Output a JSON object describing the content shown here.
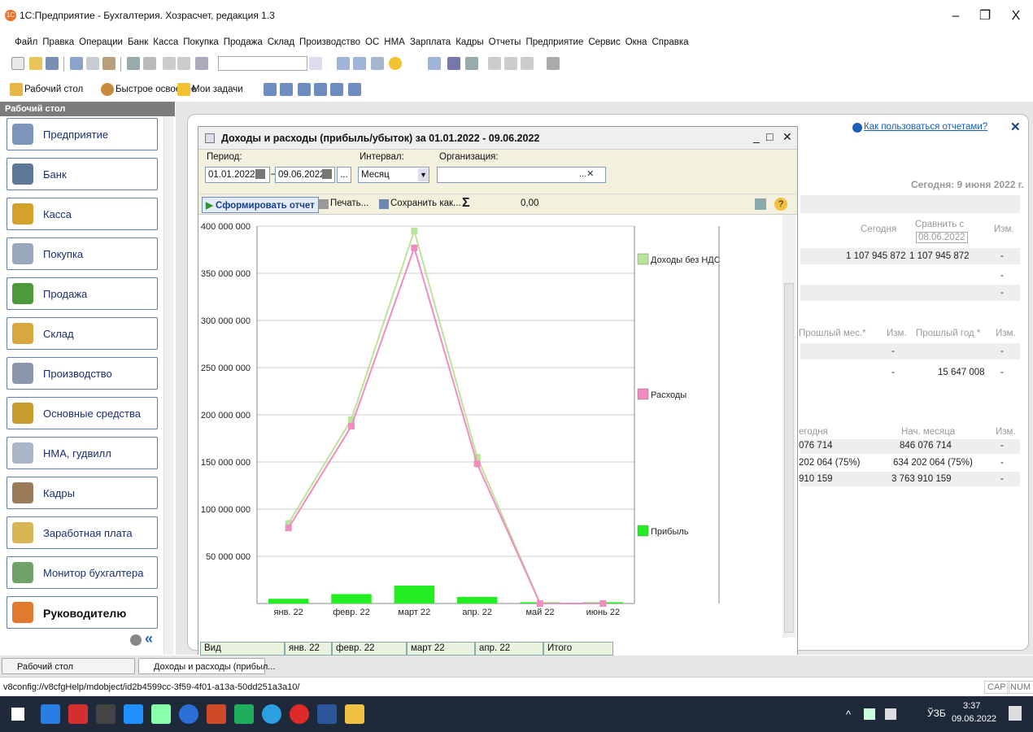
{
  "window": {
    "title": "1С:Предприятие - Бухгалтерия. Хозрасчет, редакция 1.3",
    "minimize": "–",
    "maximize": "❐",
    "close": "X",
    "app_icon": "1C"
  },
  "menu": [
    "Файл",
    "Правка",
    "Операции",
    "Банк",
    "Касса",
    "Покупка",
    "Продажа",
    "Склад",
    "Производство",
    "ОС",
    "НМА",
    "Зарплата",
    "Кадры",
    "Отчеты",
    "Предприятие",
    "Сервис",
    "Окна",
    "Справка"
  ],
  "toolbar2": {
    "desk": "Рабочий стол",
    "learn": "Быстрое освоение",
    "tasks": "Мои задачи"
  },
  "sidebar": {
    "header": "Рабочий стол",
    "items": [
      "Предприятие",
      "Банк",
      "Касса",
      "Покупка",
      "Продажа",
      "Склад",
      "Производство",
      "Основные средства",
      "НМА, гудвилл",
      "Кадры",
      "Заработная плата",
      "Монитор бухгалтера",
      "Руководителю"
    ],
    "collapse": "«"
  },
  "background": {
    "help_link": "Как пользоваться отчетами?",
    "today": "Сегодня: 9 июня 2022 г.",
    "col_today": "Сегодня",
    "col_compare": "Сравнить с",
    "compare_date": "08.06.2022",
    "col_change": "Изм.",
    "value1a": "1 107 945 872",
    "value1b": "1 107 945 872",
    "dash": "-",
    "col_prev_month": "Прошлый мес.*",
    "col_prev_year": "Прошлый год *",
    "value2": "15 647 008",
    "col_today2": "егодня",
    "col_month_start": "Нач. месяца",
    "v3a": "076 714",
    "v3b": "846 076 714",
    "v4a": "202 064  (75%)",
    "v4b": "634 202 064  (75%)",
    "v5a": "910 159",
    "v5b": "3 763 910 159"
  },
  "report": {
    "title": "Доходы и расходы (прибыль/убыток) за 01.01.2022 - 09.06.2022",
    "period_label": "Период:",
    "date_from": "01.01.2022",
    "date_to": "09.06.2022",
    "interval_label": "Интервал:",
    "interval": "Месяц",
    "org_label": "Организация:",
    "org_value": "",
    "btn_generate": "Сформировать отчет",
    "btn_print": "Печать...",
    "btn_save": "Сохранить как...",
    "sigma": "Σ",
    "sum": "0,00",
    "table_headers": [
      "Вид",
      "янв. 22",
      "февр. 22",
      "март 22",
      "апр. 22",
      "Итого"
    ]
  },
  "chart_data": {
    "type": "line",
    "categories": [
      "янв. 22",
      "февр. 22",
      "март 22",
      "апр. 22",
      "май 22",
      "июнь 22"
    ],
    "ylim": [
      0,
      400000000
    ],
    "yticks": [
      "50 000 000",
      "100 000 000",
      "150 000 000",
      "200 000 000",
      "250 000 000",
      "300 000 000",
      "350 000 000",
      "400 000 000"
    ],
    "series": [
      {
        "name": "Доходы без НДС",
        "kind": "line",
        "color": "#b8e59a",
        "values": [
          85000000,
          195000000,
          395000000,
          155000000,
          0,
          0
        ]
      },
      {
        "name": "Расходы",
        "kind": "line",
        "color": "#f08cc0",
        "values": [
          80000000,
          188000000,
          377000000,
          148000000,
          0,
          0
        ]
      },
      {
        "name": "Прибыль",
        "kind": "bar",
        "color": "#22ee22",
        "values": [
          5000000,
          10000000,
          19000000,
          7000000,
          0,
          0
        ]
      }
    ]
  },
  "tabs": [
    "Рабочий стол",
    "Доходы и расходы (прибыл..."
  ],
  "status": {
    "url": "v8config://v8cfgHelp/mdobject/id2b4599cc-3f59-4f01-a13a-50dd251a3a10/",
    "cap": "CAP",
    "num": "NUM"
  },
  "taskbar": {
    "time": "3:37",
    "date": "09.06.2022",
    "lang": "ЎЗБ"
  }
}
